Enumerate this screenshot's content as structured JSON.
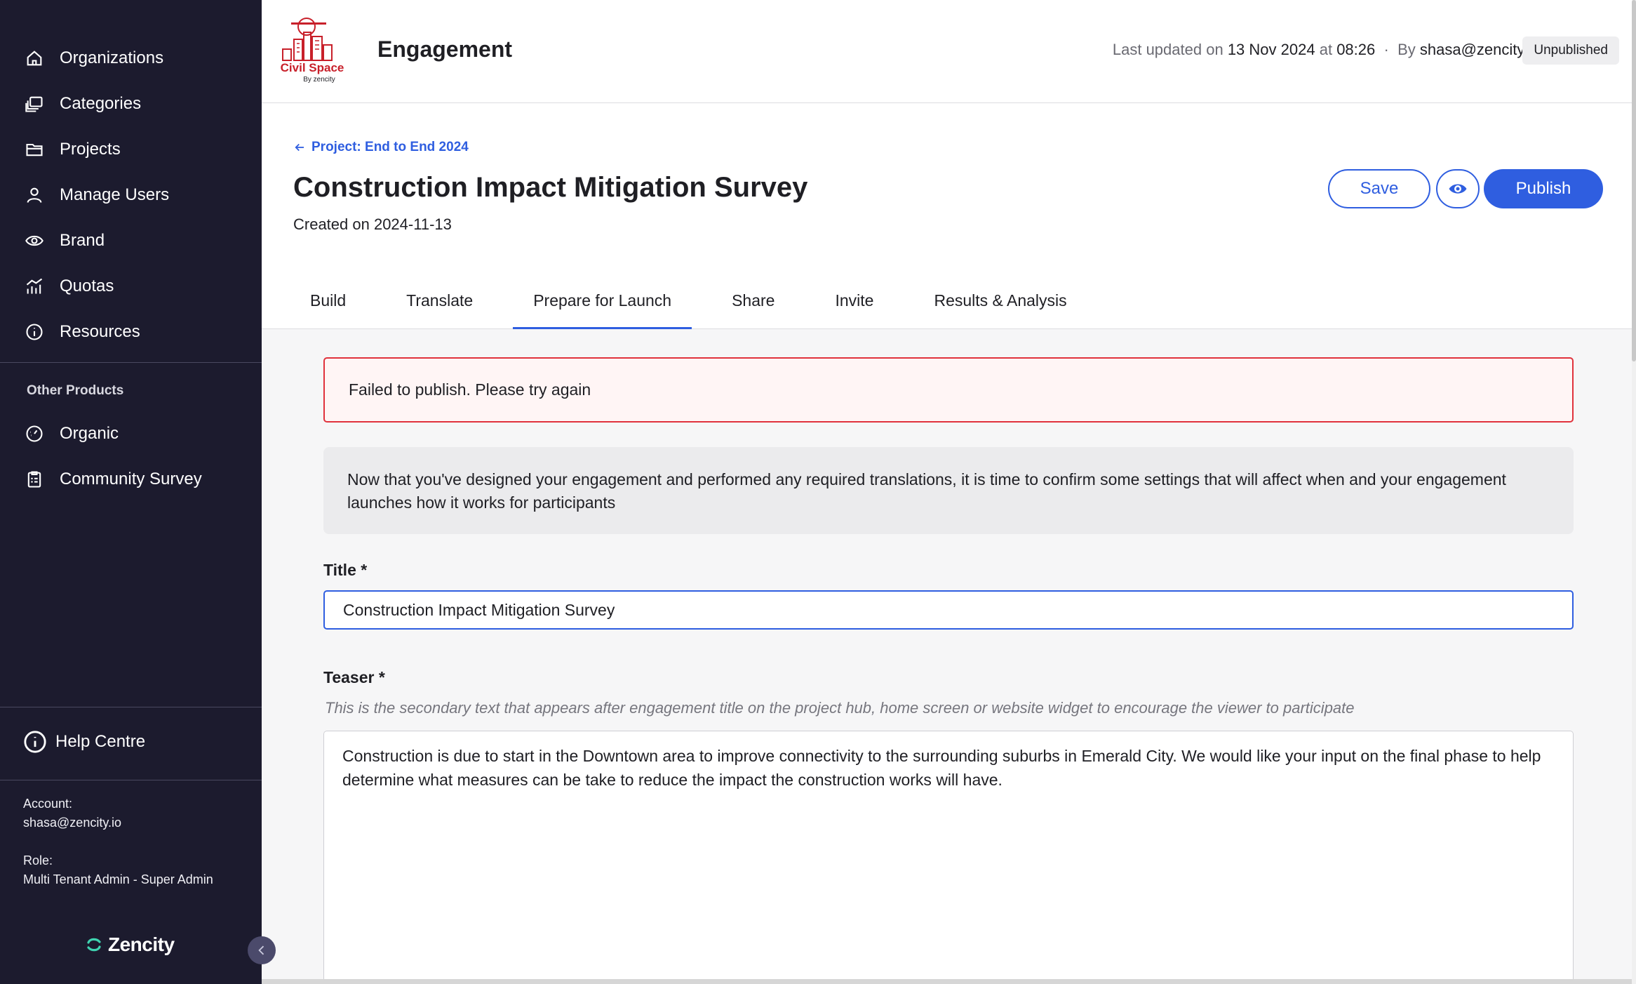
{
  "sidebar": {
    "items": [
      {
        "label": "Organizations",
        "icon": "home-icon"
      },
      {
        "label": "Categories",
        "icon": "stack-icon"
      },
      {
        "label": "Projects",
        "icon": "folder-icon"
      },
      {
        "label": "Manage Users",
        "icon": "user-icon"
      },
      {
        "label": "Brand",
        "icon": "eye-icon"
      },
      {
        "label": "Quotas",
        "icon": "chart-icon"
      },
      {
        "label": "Resources",
        "icon": "info-icon"
      }
    ],
    "other_products_label": "Other Products",
    "other_items": [
      {
        "label": "Organic",
        "icon": "gauge-icon"
      },
      {
        "label": "Community Survey",
        "icon": "clipboard-icon"
      }
    ],
    "help_label": "Help Centre",
    "account_label": "Account:",
    "account_value": "shasa@zencity.io",
    "role_label": "Role:",
    "role_value": "Multi Tenant Admin - Super Admin",
    "brand": "Zencity"
  },
  "header": {
    "title": "Engagement",
    "logo_text": "Civil Space",
    "logo_subtext": "By zencity",
    "last_updated_prefix": "Last updated on",
    "date": "13 Nov 2024",
    "at": "at",
    "time": "08:26",
    "by": "By",
    "user": "shasa@zencity.io",
    "status": "Unpublished"
  },
  "page": {
    "back_link": "Project: End to End 2024",
    "title": "Construction Impact Mitigation Survey",
    "created": "Created on 2024-11-13",
    "save_label": "Save",
    "publish_label": "Publish",
    "tabs": [
      {
        "label": "Build"
      },
      {
        "label": "Translate"
      },
      {
        "label": "Prepare for Launch",
        "active": true
      },
      {
        "label": "Share"
      },
      {
        "label": "Invite"
      },
      {
        "label": "Results & Analysis"
      }
    ]
  },
  "form": {
    "error": "Failed to publish. Please try again",
    "info": "Now that you've designed your engagement and performed any required translations, it is time to confirm some settings that will affect when and your engagement launches how it works for participants",
    "title_label": "Title *",
    "title_value": "Construction Impact Mitigation Survey",
    "teaser_label": "Teaser *",
    "teaser_hint": "This is the secondary text that appears after engagement title on the project hub, home screen or website widget to encourage the viewer to participate",
    "teaser_value": "Construction is due to start in the Downtown area to improve connectivity to the surrounding suburbs in Emerald City. We would like your input on the final phase to help determine what measures can be take to reduce the impact the construction works will have."
  },
  "colors": {
    "sidebar_bg": "#1c1b2e",
    "accent": "#2f5ee0",
    "error": "#e0323c",
    "logo_red": "#c8202a"
  }
}
